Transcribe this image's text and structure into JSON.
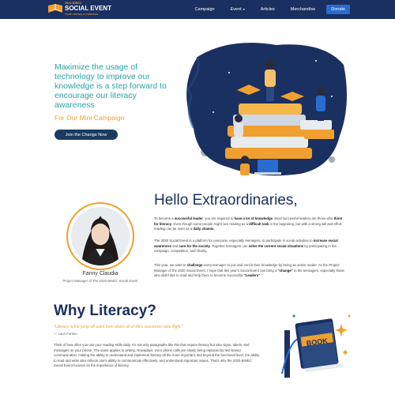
{
  "nav": {
    "logo_top": "2020 BINEC",
    "logo_main": "SOCIAL EVENT",
    "logo_sub": "Youth Literacy in Indonesia",
    "links": [
      {
        "label": "Campaign"
      },
      {
        "label": "Event"
      },
      {
        "label": "Articles"
      },
      {
        "label": "Merchandise"
      }
    ],
    "event_caret": "▾",
    "donate_label": "Donate"
  },
  "hero": {
    "title": "Maximize the usage of technology to improve our knowledge is a step forward to encourage our literacy awareness",
    "subtitle": "For Our Mini Campaign",
    "button_label": "Join the Change Now"
  },
  "hello": {
    "title": "Hello Extraordinaries,",
    "person_name": "Fanny Claudia",
    "person_role": "Project Manager of The 2020 BINEC Social Event",
    "p1": [
      "To become a ",
      "successful leader",
      ", you are required to ",
      "have a lot of knowledge",
      ". Most successful leaders are those who ",
      "thirst for literacy",
      ". Even though some people might see reading as a ",
      "difficult task",
      " in the beginning, but with a strong will and effort, reading can be seen as a ",
      "daily vitamin",
      "."
    ],
    "p2": [
      "The 2020 Social Event",
      " is a platform for everyone, especially teenagers, to participate in social activities to ",
      "increase social awareness",
      " and ",
      "care for the society",
      ". Together teenagers can ",
      "solve the current social situations",
      " by participating in the campaign, competition, and charity."
    ],
    "p3": [
      "This year, we want to ",
      "challenge",
      " every teenager to join and enrich their knowledge by being an active reader. As the Project Manager of the 2020 Social Event, I hope that this year's Social Event can bring a ",
      "\"change\"",
      " to the teenagers, especially those who didn't like to read and help them to become successful ",
      "\"Leaders\"",
      "."
    ]
  },
  "why": {
    "title": "Why Literacy?",
    "quote": "\"Literacy is the jump-off point from which all of life's successes take flight.\"",
    "quote_author": "— Lauri Fortino",
    "paragraph": "Think of how often you use your reading skills daily. It's not only paragraphs like this that require literacy but also signs, labels, and messages on your phone. The same applies to writing. Nowadays, even phone calls are slowly being replaced by text-based communication, making the ability to understand and implement literacy all the more important. But beyond the functional level, the ability to read and write also reflects one's ability to communicate effectively, and understand important issues. That's why the 2020 BINEC Social Event focuses on the importance of literacy.",
    "book_label": "BOOK"
  },
  "colors": {
    "navy": "#1a3060",
    "teal": "#2aa4a8",
    "orange": "#f0a030",
    "donate_blue": "#2a6bd0"
  }
}
